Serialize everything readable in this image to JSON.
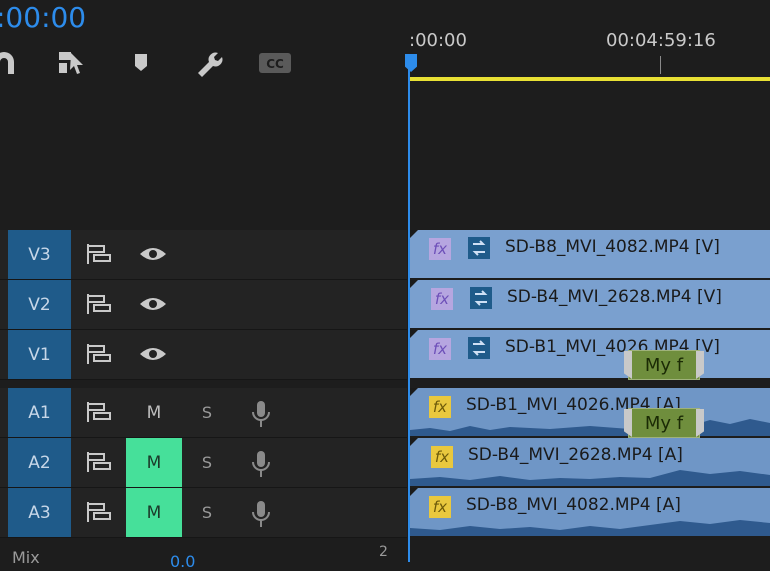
{
  "timecode": ":00:00",
  "ruler": {
    "start": ":00:00",
    "mark": "00:04:59:16"
  },
  "tools": [
    {
      "name": "snap-icon"
    },
    {
      "name": "linked-selection-icon"
    },
    {
      "name": "marker-icon"
    },
    {
      "name": "wrench-icon"
    },
    {
      "name": "captions-icon",
      "label": "CC"
    }
  ],
  "tracks": [
    {
      "id": "V3",
      "kind": "video",
      "clip": "SD-B8_MVI_4082.MP4 [V]"
    },
    {
      "id": "V2",
      "kind": "video",
      "clip": "SD-B4_MVI_2628.MP4 [V]"
    },
    {
      "id": "V1",
      "kind": "video",
      "clip": "SD-B1_MVI_4026.MP4 [V]",
      "transition": "My f"
    },
    {
      "id": "A1",
      "kind": "audio",
      "clip": "SD-B1_MVI_4026.MP4 [A]",
      "mute_label": "M",
      "solo_label": "S",
      "muted": false,
      "transition": "My f"
    },
    {
      "id": "A2",
      "kind": "audio",
      "clip": "SD-B4_MVI_2628.MP4 [A]",
      "mute_label": "M",
      "solo_label": "S",
      "muted": true
    },
    {
      "id": "A3",
      "kind": "audio",
      "clip": "SD-B8_MVI_4082.MP4 [A]",
      "mute_label": "M",
      "solo_label": "S",
      "muted": true
    }
  ],
  "fx_label": "fx",
  "mix": {
    "label": "Mix",
    "value": "0.0",
    "num": "2"
  },
  "colors": {
    "accent": "#2d8ceb",
    "track_header": "#1f5b8a",
    "clip_video": "#7aa0cf",
    "mute_on": "#46e09a",
    "work_area": "#e8e034"
  }
}
